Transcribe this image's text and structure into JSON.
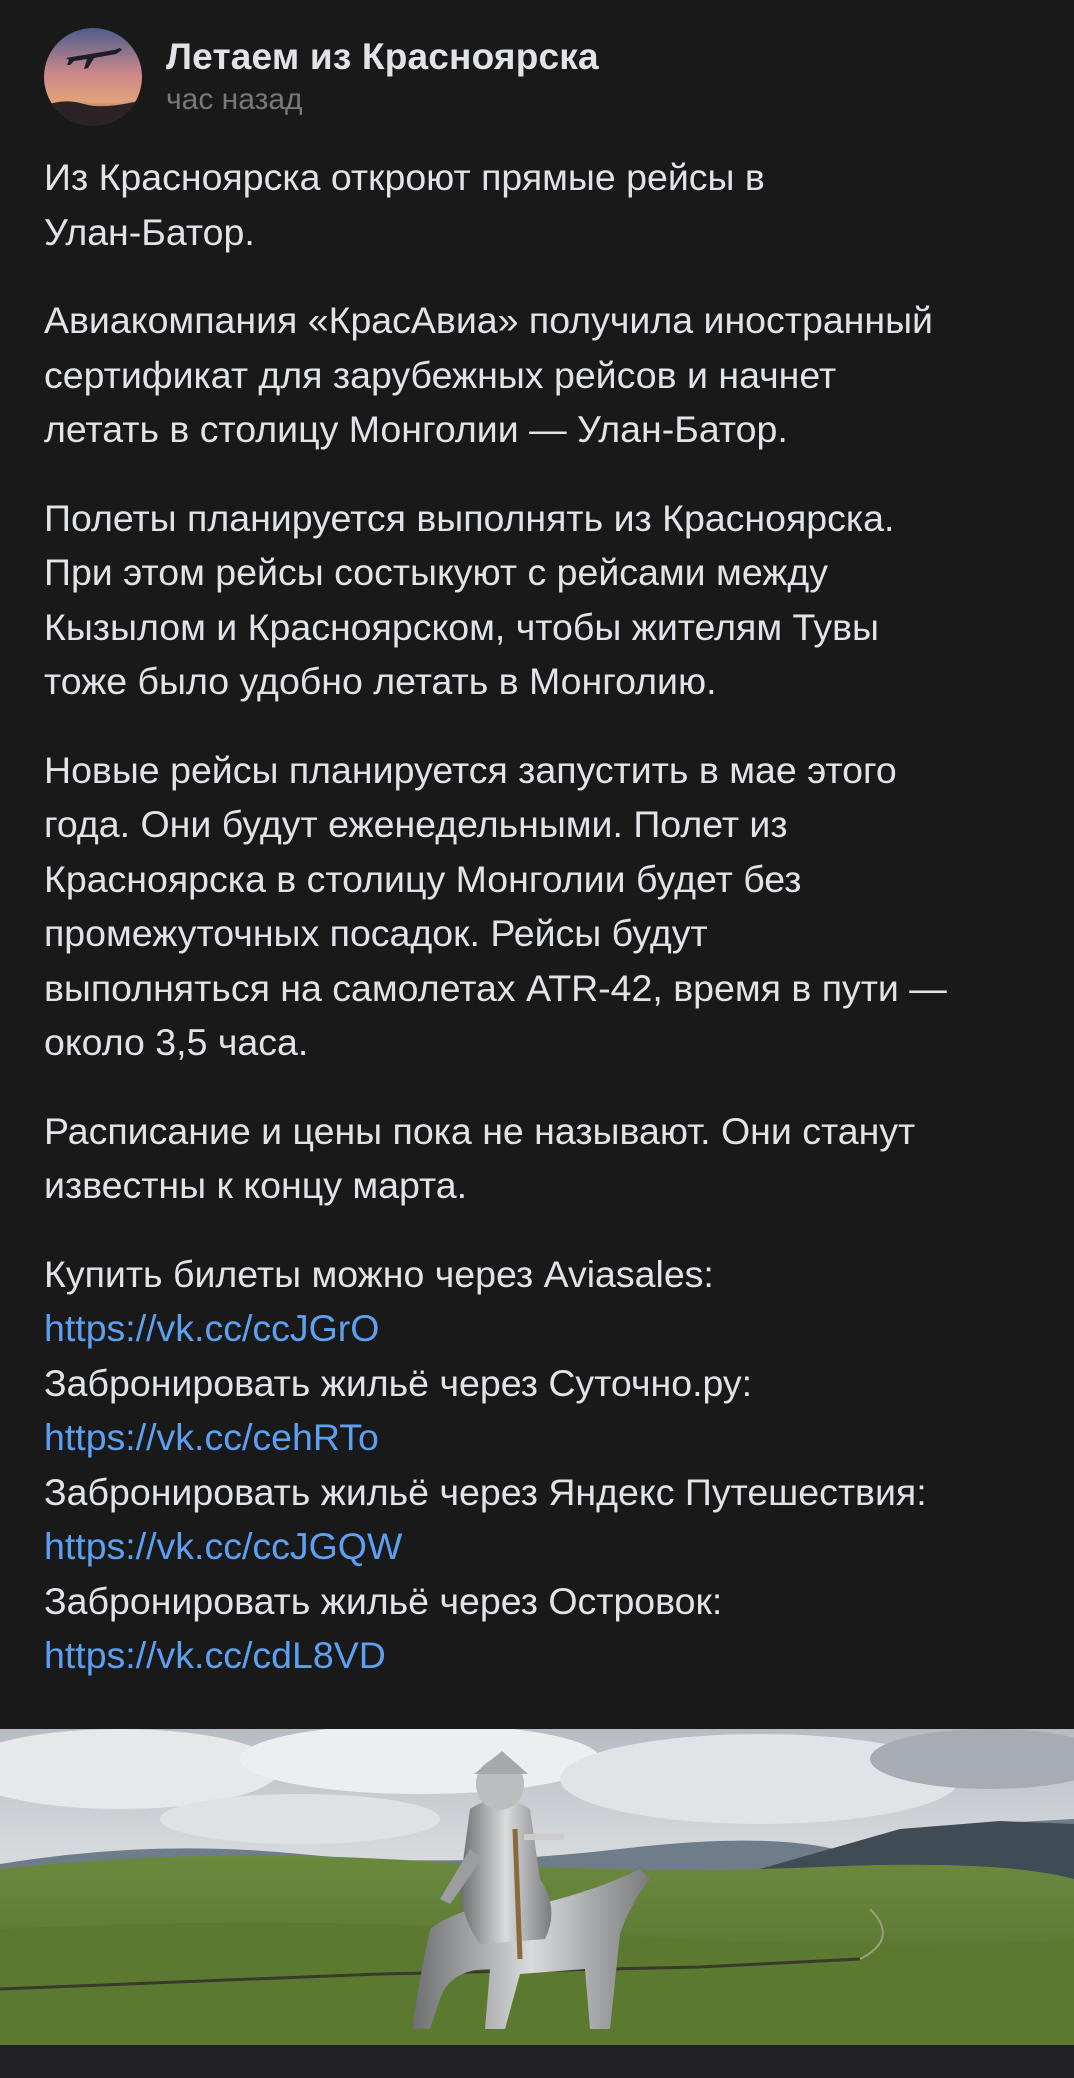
{
  "post": {
    "group_name": "Летаем из Красноярска",
    "time": "час назад",
    "paragraphs": [
      "Из Красноярска откроют прямые рейсы в\nУлан-Батор.",
      "Авиакомпания «КрасАвиа» получила иностранный\nсертификат для зарубежных рейсов и начнет\nлетать в столицу Монголии — Улан-Батор.",
      "Полеты планируется выполнять из Красноярска.\nПри этом рейсы состыкуют с рейсами между\nКызылом и Красноярском, чтобы жителям Тувы\nтоже было удобно летать в Монголию.",
      "Новые рейсы планируется запустить в мае этого\nгода. Они будут еженедельными. Полет из\nКрасноярска в столицу Монголии будет без\nпромежуточных посадок. Рейсы будут\nвыполняться на самолетах ATR-42, время в пути —\nоколо 3,5 часа.",
      "Расписание и цены пока не называют. Они станут\nизвестны к концу марта."
    ],
    "links": [
      {
        "label": "Купить билеты можно через Aviasales:",
        "url": "https://vk.cc/ccJGrO"
      },
      {
        "label": "Забронировать жильё через Суточно.ру:",
        "url": "https://vk.cc/cehRTo"
      },
      {
        "label": "Забронировать жильё через Яндекс Путешествия:",
        "url": "https://vk.cc/ccJGQW"
      },
      {
        "label": "Забронировать жильё через Островок:",
        "url": "https://vk.cc/cdL8VD"
      }
    ],
    "link_color": "#5ca0f2",
    "text_color": "#e1e3e6",
    "background_color": "#19191a"
  },
  "icons": {
    "avatar": "airplane-sunset-photo"
  }
}
